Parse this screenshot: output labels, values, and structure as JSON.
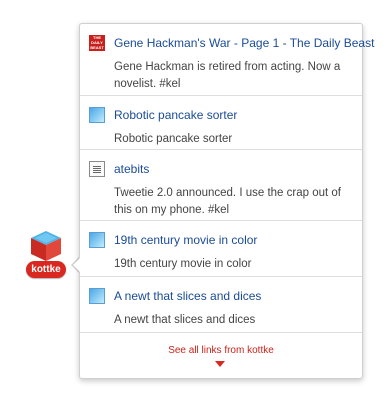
{
  "badge": {
    "label": "kottke",
    "icon": "kottke-cube-icon"
  },
  "items": [
    {
      "title": "Gene Hackman's War - Page 1 - The Daily Beast",
      "description": "Gene Hackman is retired from acting. Now a novelist. #kel",
      "favicon": "daily-beast-favicon",
      "favicon_text": "THE DAILY BEAST"
    },
    {
      "title": "Robotic pancake sorter",
      "description": "Robotic pancake sorter",
      "favicon": "blue-square-favicon"
    },
    {
      "title": "atebits",
      "description": "Tweetie 2.0 announced. I use the crap out of this on my phone. #kel",
      "favicon": "document-favicon"
    },
    {
      "title": "19th century movie in color",
      "description": "19th century movie in color",
      "favicon": "blue-square-favicon"
    },
    {
      "title": "A newt that slices and dices",
      "description": "A newt that slices and dices",
      "favicon": "blue-square-favicon"
    }
  ],
  "footer": {
    "link": "See all links from kottke",
    "arrow_icon": "down-arrow-icon"
  },
  "colors": {
    "link_blue": "#1a4c96",
    "accent_red": "#d8281f",
    "text_gray": "#444444"
  }
}
